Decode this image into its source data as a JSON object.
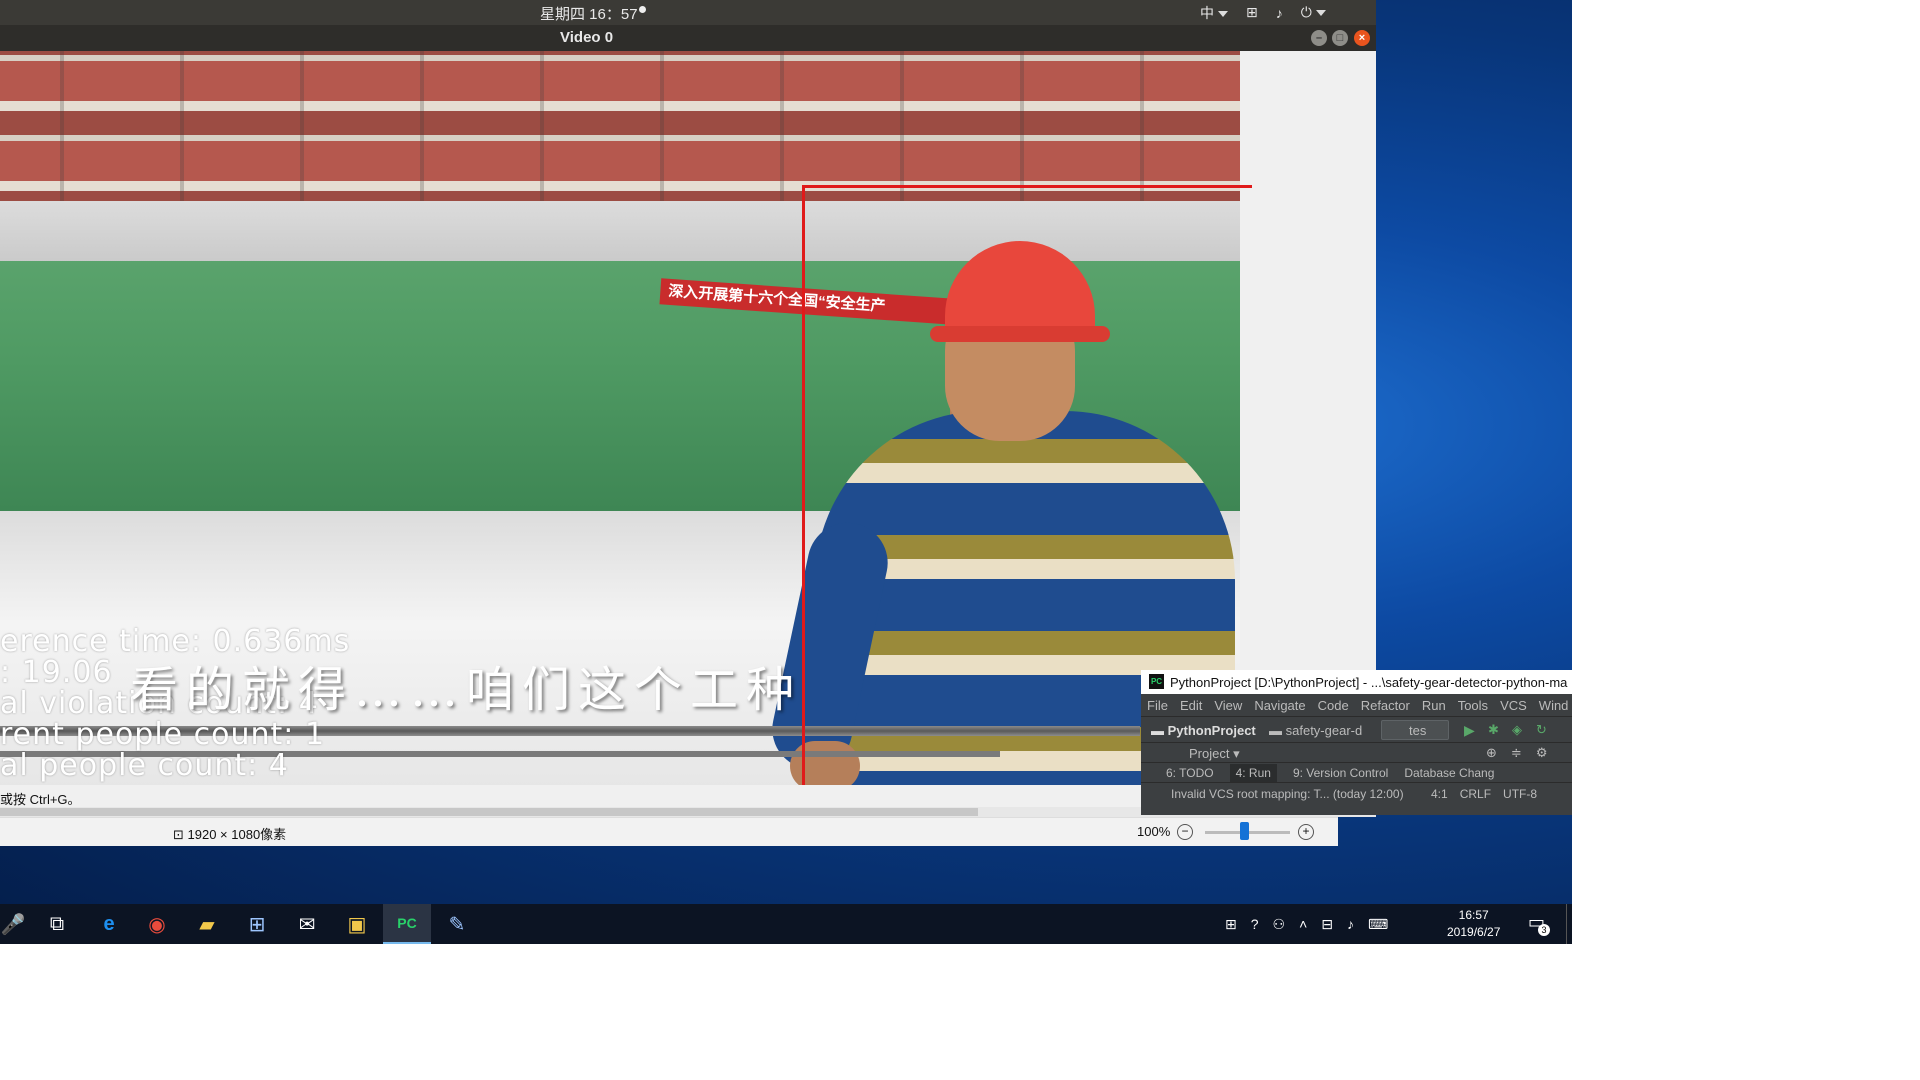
{
  "ubuntu": {
    "clock": "星期四 16：57",
    "input_method": "中",
    "window_title": "Video 0",
    "controls": {
      "minimize": "–",
      "maximize": "□",
      "close": "×"
    }
  },
  "video": {
    "banner_text": "深入开展第十六个全国“安全生产",
    "overlay": [
      "erence  time:  0.636ms",
      ":  19.06",
      "al  violation  count:  4",
      "rent  people  count:  1",
      "al  people  count:  4"
    ],
    "subtitle": "看的就得……咱们这个工种"
  },
  "viewer": {
    "hint": "或按 Ctrl+G。",
    "dimensions": "1920 × 1080像素",
    "zoom": "100%",
    "zoom_out": "−",
    "zoom_in": "+"
  },
  "pycharm": {
    "logo": "PC",
    "title": "PythonProject [D:\\PythonProject] - ...\\safety-gear-detector-python-ma",
    "menu": [
      "File",
      "Edit",
      "View",
      "Navigate",
      "Code",
      "Refactor",
      "Run",
      "Tools",
      "VCS",
      "Wind"
    ],
    "nav": {
      "project": "PythonProject",
      "folder": "safety-gear-d",
      "run_config": "tes"
    },
    "project_label": "Project",
    "toolwindows": [
      "6: TODO",
      "4: Run",
      "9: Version Control",
      "Database Chang"
    ],
    "status_msg": "Invalid VCS root mapping: T... (today 12:00)",
    "status_right": [
      "4:1",
      "CRLF",
      "UTF-8"
    ]
  },
  "taskbar": {
    "apps": [
      "mic-icon",
      "task-view-icon",
      "edge-icon",
      "chrome-icon",
      "file-explorer-icon",
      "store-icon",
      "mail-icon",
      "sticky-app-icon",
      "pycharm-icon",
      "paint-icon"
    ],
    "time": "16:57",
    "date": "2019/6/27",
    "notifications": "3"
  }
}
